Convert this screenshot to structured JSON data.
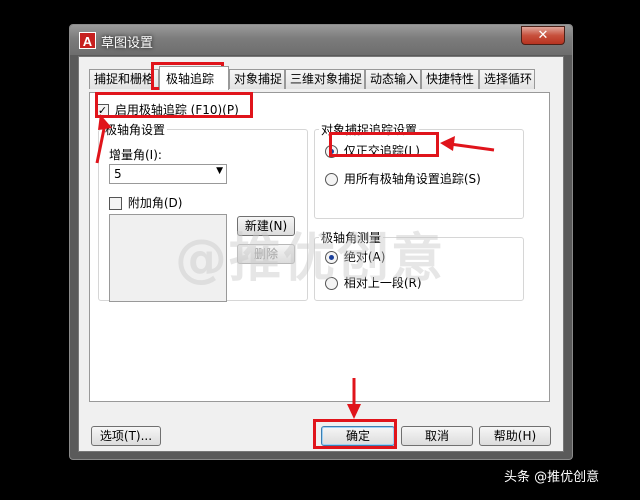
{
  "window": {
    "title": "草图设置",
    "app_icon_letter": "A",
    "close_glyph": "✕"
  },
  "tabs": [
    {
      "label": "捕捉和栅格"
    },
    {
      "label": "极轴追踪"
    },
    {
      "label": "对象捕捉"
    },
    {
      "label": "三维对象捕捉"
    },
    {
      "label": "动态输入"
    },
    {
      "label": "快捷特性"
    },
    {
      "label": "选择循环"
    }
  ],
  "polar": {
    "enable_label": "启用极轴追踪 (F10)(P)",
    "enable_checked": true,
    "angle_settings_title": "极轴角设置",
    "increment_label": "增量角(I):",
    "increment_value": "5",
    "additional_label": "附加角(D)",
    "additional_checked": false,
    "new_button": "新建(N)",
    "delete_button": "删除"
  },
  "snap_tracking": {
    "title": "对象捕捉追踪设置",
    "orthogonal_label": "仅正交追踪(L)",
    "orthogonal_selected": true,
    "all_polar_label": "用所有极轴角设置追踪(S)",
    "all_polar_selected": false
  },
  "measurement": {
    "title": "极轴角测量",
    "absolute_label": "绝对(A)",
    "absolute_selected": true,
    "relative_label": "相对上一段(R)",
    "relative_selected": false
  },
  "footer": {
    "options_button": "选项(T)...",
    "ok_button": "确定",
    "cancel_button": "取消",
    "help_button": "帮助(H)"
  },
  "watermark": "@推优创意",
  "credit": "头条 @推优创意",
  "colors": {
    "highlight": "#e0141b",
    "radio_dot": "#1a3f9a"
  }
}
